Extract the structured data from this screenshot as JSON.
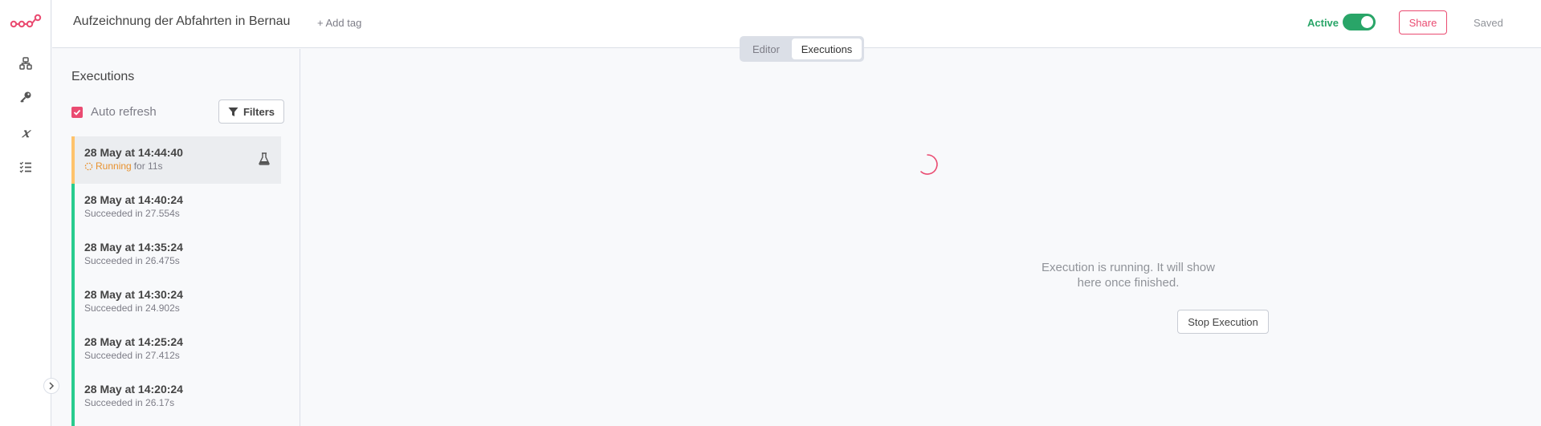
{
  "header": {
    "workflow_name": "Aufzeichnung der Abfahrten in Bernau",
    "add_tag": "+ Add tag",
    "active_label": "Active",
    "active": true,
    "share_label": "Share",
    "saved_label": "Saved"
  },
  "tabs": [
    {
      "label": "Editor",
      "selected": false
    },
    {
      "label": "Executions",
      "selected": true
    }
  ],
  "rail": {
    "icons": [
      "n8n-logo-icon",
      "workflows-icon",
      "credentials-key-icon",
      "variables-icon",
      "executions-list-icon",
      "expand-chevron-icon"
    ]
  },
  "executions_panel": {
    "title": "Executions",
    "auto_refresh_label": "Auto refresh",
    "auto_refresh_checked": true,
    "filters_label": "Filters",
    "items": [
      {
        "time": "28 May at 14:44:40",
        "status_word": "Running",
        "status_rest": "for 11s",
        "state": "running"
      },
      {
        "time": "28 May at 14:40:24",
        "status": "Succeeded in 27.554s",
        "state": "success"
      },
      {
        "time": "28 May at 14:35:24",
        "status": "Succeeded in 26.475s",
        "state": "success"
      },
      {
        "time": "28 May at 14:30:24",
        "status": "Succeeded in 24.902s",
        "state": "success"
      },
      {
        "time": "28 May at 14:25:24",
        "status": "Succeeded in 27.412s",
        "state": "success"
      },
      {
        "time": "28 May at 14:20:24",
        "status": "Succeeded in 26.17s",
        "state": "success"
      }
    ]
  },
  "main": {
    "running_message": "Execution is running. It will show here once finished.",
    "stop_label": "Stop Execution"
  },
  "colors": {
    "brand": "#ea4b71",
    "success": "#29cc8e",
    "active_green": "#29a568",
    "running_orange": "#e8912d",
    "running_border": "#ffc36b"
  }
}
